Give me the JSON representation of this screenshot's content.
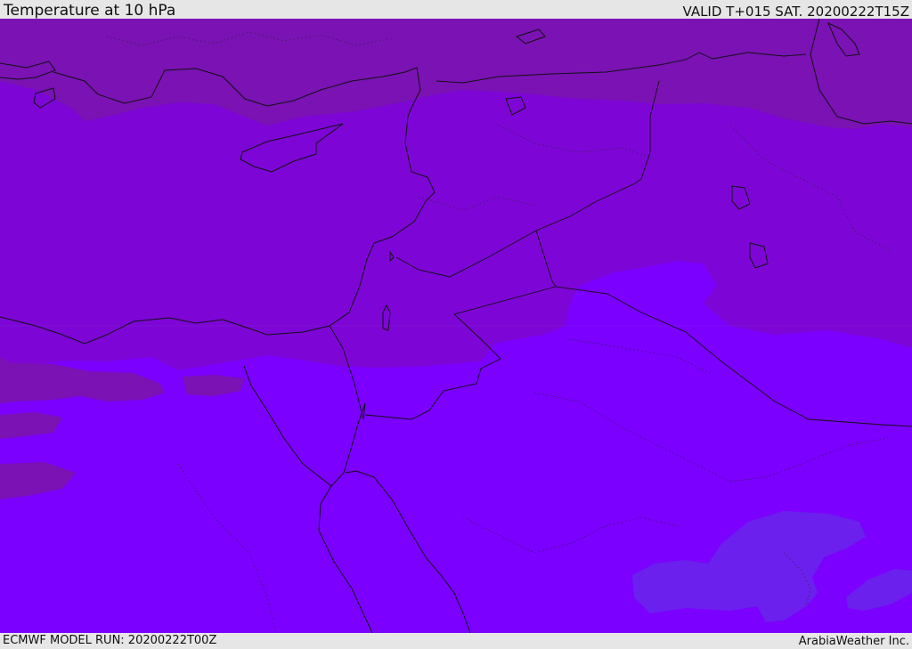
{
  "header": {
    "title": "Temperature at 10 hPa",
    "valid": "VALID T+015 SAT. 20200222T15Z"
  },
  "footer": {
    "model_run": "ECMWF MODEL RUN: 20200222T00Z",
    "credit": "ArabiaWeather Inc."
  },
  "map": {
    "palette": {
      "warm_band": "#7a12b4",
      "mid_band": "#7d06d6",
      "cool_band": "#7b00ff",
      "cold_patch": "#6b20ee",
      "coastline": "#111111"
    }
  }
}
